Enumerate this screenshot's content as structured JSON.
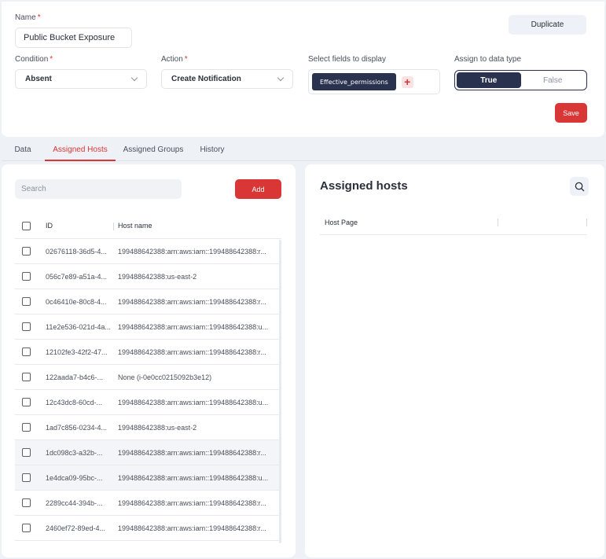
{
  "form": {
    "name_label": "Name",
    "required_mark": "*",
    "name_value": "Public Bucket Exposure",
    "condition_label": "Condition",
    "condition_value": "Absent",
    "action_label": "Action",
    "action_value": "Create Notification",
    "fields_label": "Select fields to display",
    "field_chip": "Effective_permissions",
    "assign_label": "Assign to data type",
    "toggle_true": "True",
    "toggle_false": "False",
    "duplicate_label": "Duplicate",
    "save_label": "Save"
  },
  "tabs": [
    {
      "label": "Data",
      "active": false
    },
    {
      "label": "Assigned Hosts",
      "active": true
    },
    {
      "label": "Assigned Groups",
      "active": false
    },
    {
      "label": "History",
      "active": false
    }
  ],
  "left": {
    "search_placeholder": "Search",
    "add_label": "Add",
    "columns": {
      "id": "ID",
      "host": "Host name"
    },
    "rows": [
      {
        "id": "02676118-36d5-4...",
        "host": "199488642388:arn:aws:iam::199488642388:r...",
        "highlight": false
      },
      {
        "id": "056c7e89-a51a-4...",
        "host": "199488642388:us-east-2",
        "highlight": false
      },
      {
        "id": "0c46410e-80c8-4...",
        "host": "199488642388:arn:aws:iam::199488642388:r...",
        "highlight": false
      },
      {
        "id": "11e2e536-021d-4a...",
        "host": "199488642388:arn:aws:iam::199488642388:u...",
        "highlight": false
      },
      {
        "id": "12102fe3-42f2-47...",
        "host": "199488642388:arn:aws:iam::199488642388:r...",
        "highlight": false
      },
      {
        "id": "122aada7-b4c6-...",
        "host": "None (i-0e0cc0215092b3e12)",
        "highlight": false
      },
      {
        "id": "12c43dc8-60cd-...",
        "host": "199488642388:arn:aws:iam::199488642388:u...",
        "highlight": false
      },
      {
        "id": "1ad7c856-0234-4...",
        "host": "199488642388:us-east-2",
        "highlight": false
      },
      {
        "id": "1dc098c3-a32b-...",
        "host": "199488642388:arn:aws:iam::199488642388:r...",
        "highlight": true
      },
      {
        "id": "1e4dca09-95bc-...",
        "host": "199488642388:arn:aws:iam::199488642388:u...",
        "highlight": true
      },
      {
        "id": "2289cc44-394b-...",
        "host": "199488642388:arn:aws:iam::199488642388:r...",
        "highlight": false
      },
      {
        "id": "2460ef72-89ed-4...",
        "host": "199488642388:arn:aws:iam::199488642388:r...",
        "highlight": false
      }
    ]
  },
  "right": {
    "title": "Assigned hosts",
    "column": "Host Page"
  },
  "colors": {
    "accent_red": "#d93636",
    "navy": "#29334f",
    "background": "#eef1f6"
  },
  "icons": {
    "search": "search-icon",
    "chevron": "chevron-down-icon",
    "add": "plus-icon"
  }
}
